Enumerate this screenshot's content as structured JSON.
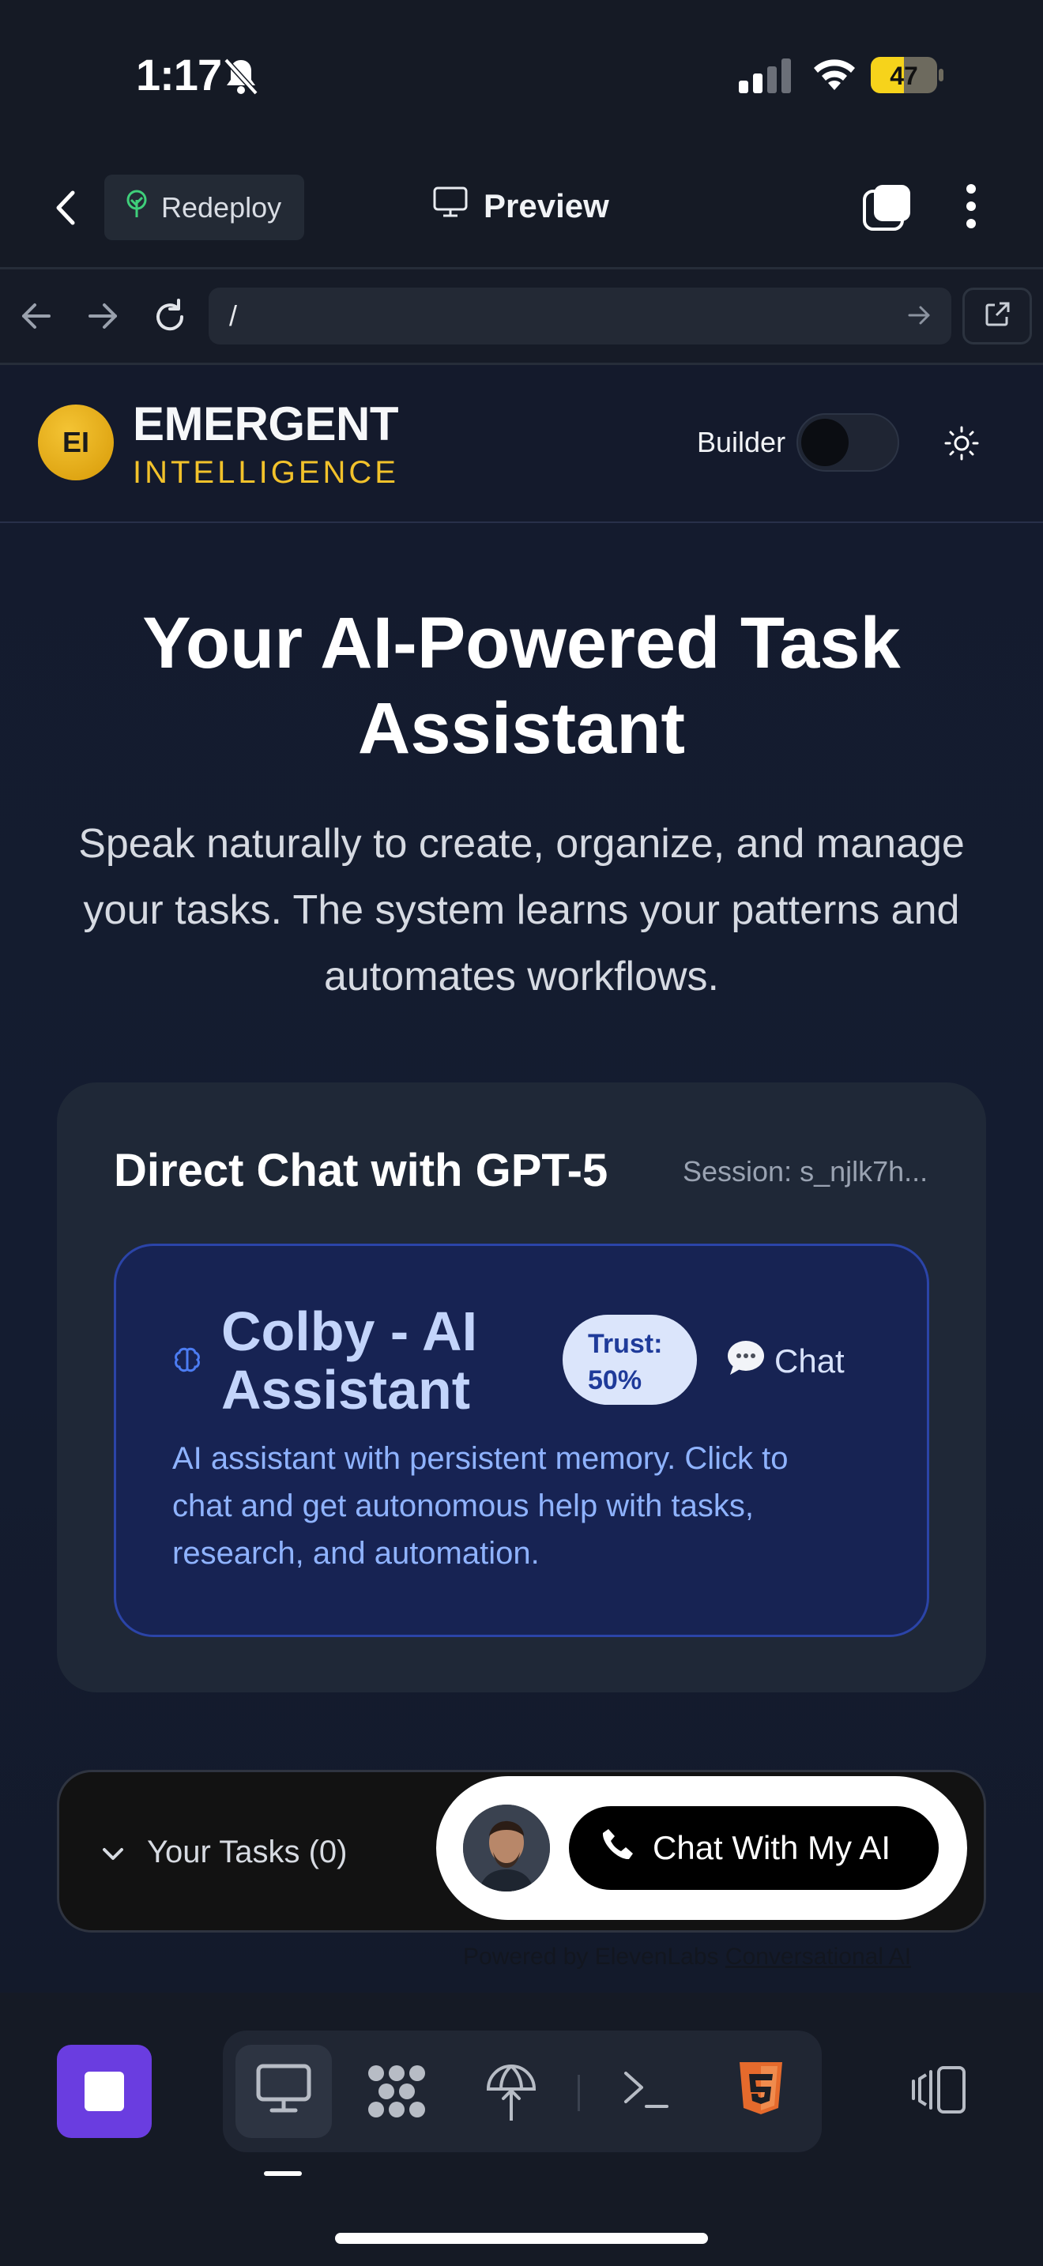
{
  "status_bar": {
    "time": "1:17",
    "battery": "47",
    "icons": [
      "bell-slash-icon",
      "signal-icon",
      "wifi-icon",
      "battery-icon"
    ]
  },
  "app_bar": {
    "redeploy_label": "Redeploy",
    "preview_label": "Preview",
    "icons": [
      "back-icon",
      "tree-icon",
      "monitor-icon",
      "tabs-icon",
      "more-icon"
    ]
  },
  "url_bar": {
    "url": "/"
  },
  "site": {
    "logo_text": "EI",
    "brand_line1": "EMERGENT",
    "brand_line2": "INTELLIGENCE",
    "builder_label": "Builder",
    "builder_on": false
  },
  "hero": {
    "title": "Your AI-Powered Task Assistant",
    "subtitle": "Speak naturally to create, organize, and manage your tasks. The system learns your patterns and automates workflows."
  },
  "chat_card": {
    "title": "Direct Chat with GPT-5",
    "session": "Session: s_njlk7h...",
    "assistant": {
      "name": "Colby - AI Assistant",
      "trust": "Trust: 50%",
      "chat_label": "Chat",
      "description": "AI assistant with persistent memory. Click to chat and get autonomous help with tasks, research, and automation."
    }
  },
  "tasks": {
    "label": "Your Tasks (0)"
  },
  "voice_widget": {
    "button_label": "Chat With My AI",
    "powered_prefix": "Powered by ElevenLabs",
    "powered_link": "Conversational AI"
  },
  "toolbar": {
    "icons": [
      "stop-icon",
      "monitor-icon",
      "app-grid-icon",
      "deploy-icon",
      "terminal-icon",
      "html5-icon",
      "split-view-icon"
    ]
  },
  "colors": {
    "background": "#151a25",
    "accent_gold": "#f2c22b",
    "stop_purple": "#6a3de0",
    "card_blue": "#172353",
    "html5_orange": "#e56a2c"
  }
}
